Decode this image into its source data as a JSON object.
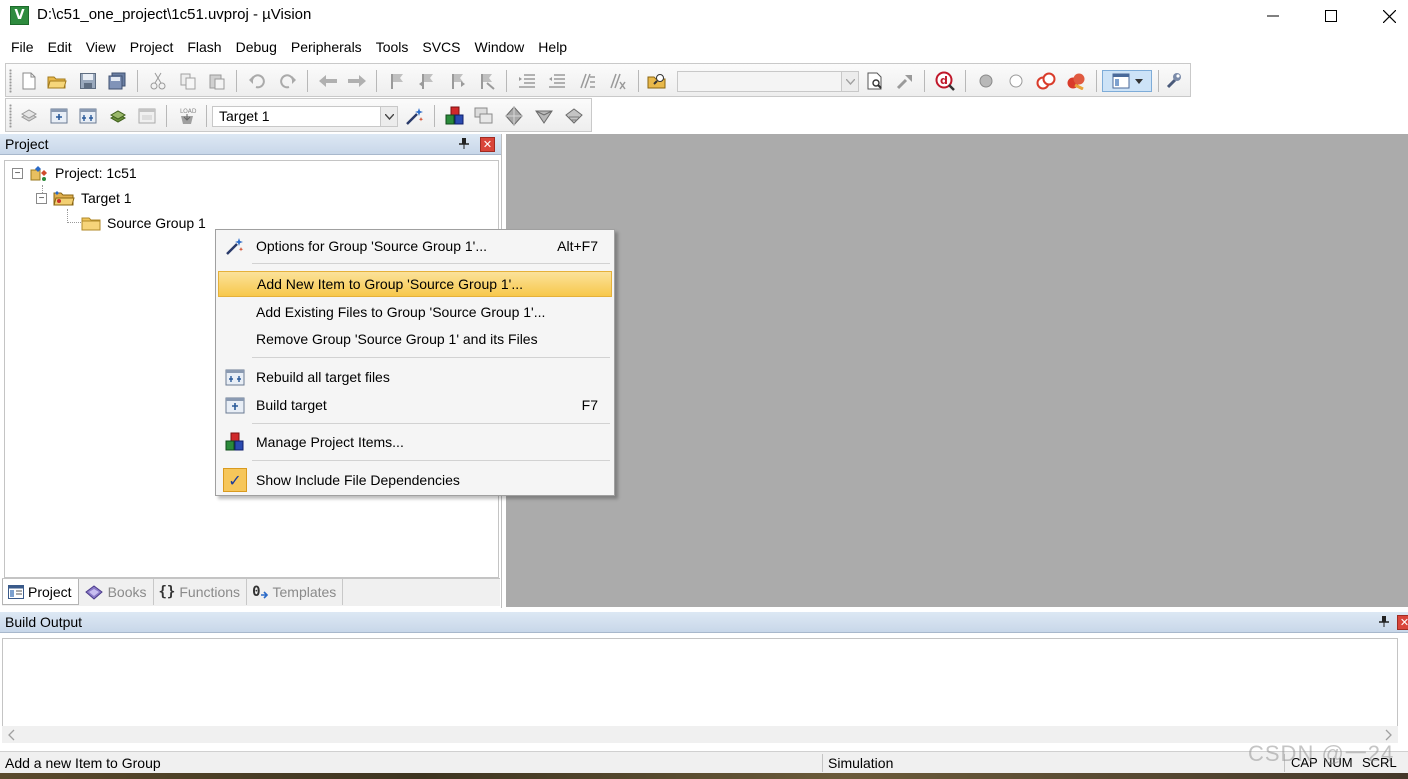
{
  "window": {
    "title": "D:\\c51_one_project\\1c51.uvproj - µVision",
    "app_icon_letter": "V"
  },
  "menubar": {
    "items": [
      "File",
      "Edit",
      "View",
      "Project",
      "Flash",
      "Debug",
      "Peripherals",
      "Tools",
      "SVCS",
      "Window",
      "Help"
    ]
  },
  "toolbar2": {
    "target_select": "Target 1"
  },
  "toolbar1": {
    "find_combo_value": ""
  },
  "project_panel": {
    "title": "Project",
    "tree": {
      "project": "Project: 1c51",
      "target": "Target 1",
      "group": "Source Group 1"
    },
    "tabs": [
      "Project",
      "Books",
      "Functions",
      "Templates"
    ],
    "tab_glyphs": {
      "functions": "{}",
      "templates": "0"
    }
  },
  "context_menu": {
    "items": [
      {
        "label": "Options for Group 'Source Group 1'...",
        "shortcut": "Alt+F7",
        "icon": "magic-wand-icon"
      },
      {
        "label": "Add New  Item to Group 'Source Group 1'...",
        "shortcut": "",
        "icon": "",
        "highlighted": true
      },
      {
        "label": "Add Existing Files to Group 'Source Group 1'...",
        "shortcut": "",
        "icon": ""
      },
      {
        "label": "Remove Group 'Source Group 1' and its Files",
        "shortcut": "",
        "icon": ""
      },
      {
        "label": "Rebuild all target files",
        "shortcut": "",
        "icon": "rebuild-icon"
      },
      {
        "label": "Build target",
        "shortcut": "F7",
        "icon": "build-icon"
      },
      {
        "label": "Manage Project Items...",
        "shortcut": "",
        "icon": "manage-items-icon"
      },
      {
        "label": "Show Include File Dependencies",
        "shortcut": "",
        "icon": "check-icon",
        "checked": true
      }
    ],
    "check_glyph": "✓"
  },
  "build_output": {
    "title": "Build Output",
    "content": ""
  },
  "statusbar": {
    "message": "Add a new Item to Group",
    "mode": "Simulation",
    "cap": "CAP",
    "num": "NUM",
    "scrl": "SCRL"
  },
  "watermark": "CSDN @一24",
  "colors": {
    "highlight": "#f7c84c",
    "editor_bg": "#ababab",
    "pane_header": "#c8d7e9",
    "close_red": "#d9453a"
  }
}
